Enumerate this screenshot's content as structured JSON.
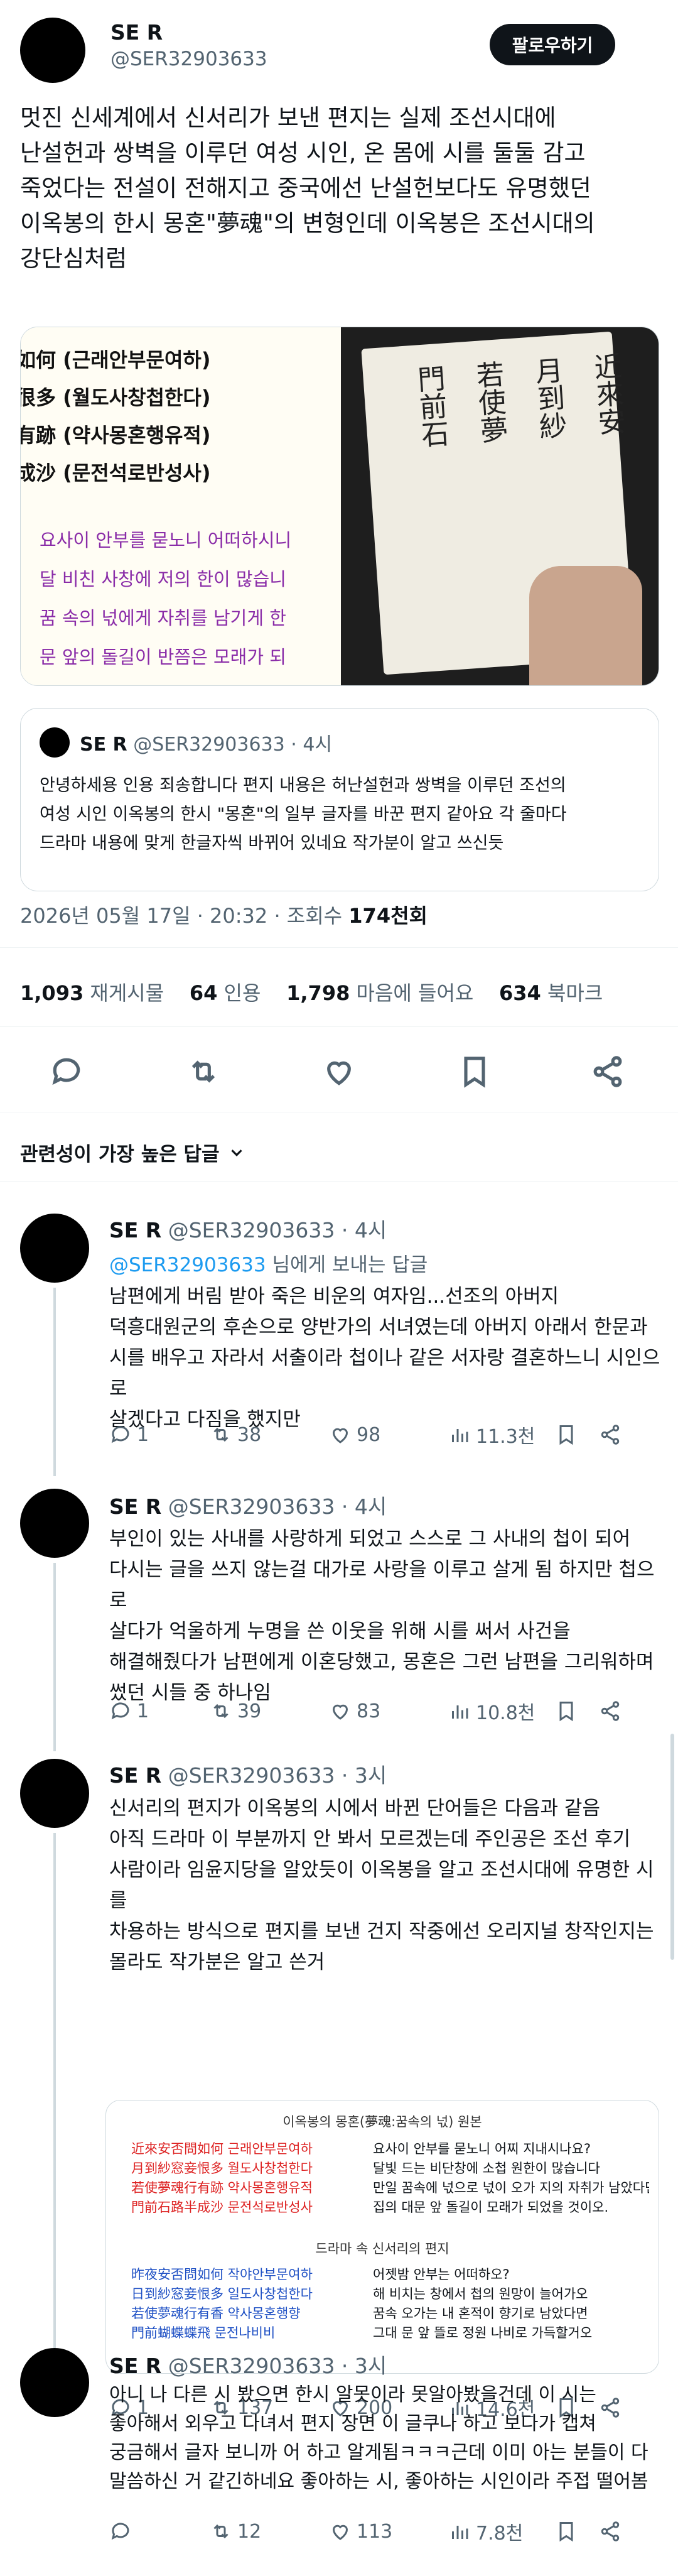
{
  "main_tweet": {
    "author_name": "SE R",
    "author_handle": "@SER32903633",
    "follow_label": "팔로우하기",
    "text": "멋진 신세계에서 신서리가 보낸 편지는 실제 조선시대에\n난설헌과 쌍벽을 이루던 여성 시인, 온 몸에 시를 둘둘 감고\n죽었다는 전설이 전해지고 중국에선 난설헌보다도 유명했던\n이옥봉의 한시 몽혼\"夢魂\"의 변형인데 이옥봉은 조선시대의\n강단심처럼",
    "media_left_lines": [
      "如何 (근래안부문여하)",
      "很多 (월도사창첩한다)",
      "有跡 (약사몽혼행유적)",
      "成沙 (문전석로반성사)"
    ],
    "media_left_purple": [
      "요사이 안부를 묻노니 어떠하시니",
      "달 비친 사창에 저의 한이 많습니",
      "꿈 속의 넋에게 자취를 남기게 한",
      "문 앞의 돌길이 반쯤은 모래가 되"
    ],
    "media_right_columns": [
      "門前石",
      "若使夢",
      "月到紗",
      "近來安"
    ],
    "quote": {
      "author_name": "SE R",
      "author_handle": "@SER32903633",
      "time": "· 4시",
      "text": "안녕하세용 인용 죄송합니다 편지 내용은 허난설헌과 쌍벽을 이루던 조선의\n여성 시인 이옥봉의 한시 \"몽혼\"의 일부 글자를 바꾼 편지 같아요 각 줄마다\n드라마 내용에 맞게 한글자씩 바뀌어 있네요 작가분이 알고 쓰신듯"
    },
    "date_line": "2026년 05월 17일 · 20:32 · 조회수",
    "views": "174천회",
    "stats": [
      {
        "num": "1,093",
        "label": "재게시물"
      },
      {
        "num": "64",
        "label": "인용"
      },
      {
        "num": "1,798",
        "label": "마음에 들어요"
      },
      {
        "num": "634",
        "label": "북마크"
      }
    ],
    "icons": [
      "reply-icon",
      "retweet-icon",
      "like-icon",
      "bookmark-icon",
      "share-icon"
    ]
  },
  "replies_sort_label": "관련성이 가장 높은 답글",
  "replies": [
    {
      "author_name": "SE R",
      "author_handle": "@SER32903633",
      "time": "· 4시",
      "mention": "@SER32903633",
      "mention_suffix": " 님에게 보내는 답글",
      "text": "남편에게 버림 받아 죽은 비운의 여자임...선조의 아버지\n덕흥대원군의 후손으로 양반가의 서녀였는데 아버지 아래서 한문과\n시를 배우고 자라서 서출이라 첩이나 같은 서자랑 결혼하느니 시인으로\n살겠다고 다짐을 했지만",
      "replies": "1",
      "retweets": "38",
      "likes": "98",
      "views": "11.3천"
    },
    {
      "author_name": "SE R",
      "author_handle": "@SER32903633",
      "time": "· 4시",
      "text": "부인이 있는 사내를 사랑하게 되었고 스스로 그 사내의 첩이 되어\n다시는 글을 쓰지 않는걸 대가로 사랑을 이루고 살게 됨 하지만 첩으로\n살다가 억울하게 누명을 쓴 이웃을 위해 시를 써서 사건을\n해결해줬다가 남편에게 이혼당했고, 몽혼은 그런 남편을 그리워하며\n썼던 시들 중 하나임",
      "replies": "1",
      "retweets": "39",
      "likes": "83",
      "views": "10.8천"
    },
    {
      "author_name": "SE R",
      "author_handle": "@SER32903633",
      "time": "· 3시",
      "text": "신서리의 편지가 이옥봉의 시에서 바뀐 단어들은 다음과 같음\n아직 드라마 이 부분까지 안 봐서 모르겠는데 주인공은 조선 후기\n사람이라 임윤지당을 알았듯이 이옥봉을 알고 조선시대에 유명한 시를\n차용하는 방식으로 편지를 보낸 건지 작중에선 오리지널 창작인지는\n몰라도 작가분은 알고 쓴거",
      "doc_title": "이옥봉의 몽혼(夢魂:꿈속의 넋) 원본",
      "doc_left": [
        "近來安否問如何 근래안부문여하",
        "月到紗窓妾恨多 월도사창첩한다",
        "若使夢魂行有跡 약사몽혼행유적",
        "門前石路半成沙 문전석로반성사"
      ],
      "doc_right": [
        "요사이 안부를 묻노니 어찌 지내시나요?",
        "달빛 드는 비단창에 소첩 원한이 많습니다",
        "만일 꿈속에 넋으로 넋이 오가 지의 자취가 남았다면",
        "집의 대문 앞 돌길이 모래가 되었을 것이오."
      ],
      "doc_subtitle": "드라마 속 신서리의 편지",
      "doc_left2": [
        "昨夜安否問如何 작야안부문여하",
        "日到紗窓妾恨多 일도사창첩한다",
        "若使夢魂行有香 약사몽혼행향",
        "門前蝴蝶蝶飛 문전나비비"
      ],
      "doc_right2": [
        "어젯밤 안부는 어떠하오?",
        "해 비치는 창에서 첩의 원망이 늘어가오",
        "꿈속 오가는 내 혼적이 향기로 남았다면",
        "그대 문 앞 뜰로 정원 나비로 가득할거오"
      ],
      "replies": "1",
      "retweets": "137",
      "likes": "200",
      "views": "14.6천"
    },
    {
      "author_name": "SE R",
      "author_handle": "@SER32903633",
      "time": "· 3시",
      "text": "아니 나 다른 시 봤으면 한시 알못이라 못알아봤을건데 이 시는\n좋아해서 외우고 다녀서 편지 장면 이 글쿠나 하고 보다가 캡쳐\n궁금해서 글자 보니까 어 하고 알게됨ㅋㅋㅋ근데 이미 아는 분들이 다\n말씀하신 거 같긴하네요 좋아하는 시, 좋아하는 시인이라 주접 떨어봄",
      "replies": "",
      "retweets": "12",
      "likes": "113",
      "views": "7.8천"
    }
  ]
}
